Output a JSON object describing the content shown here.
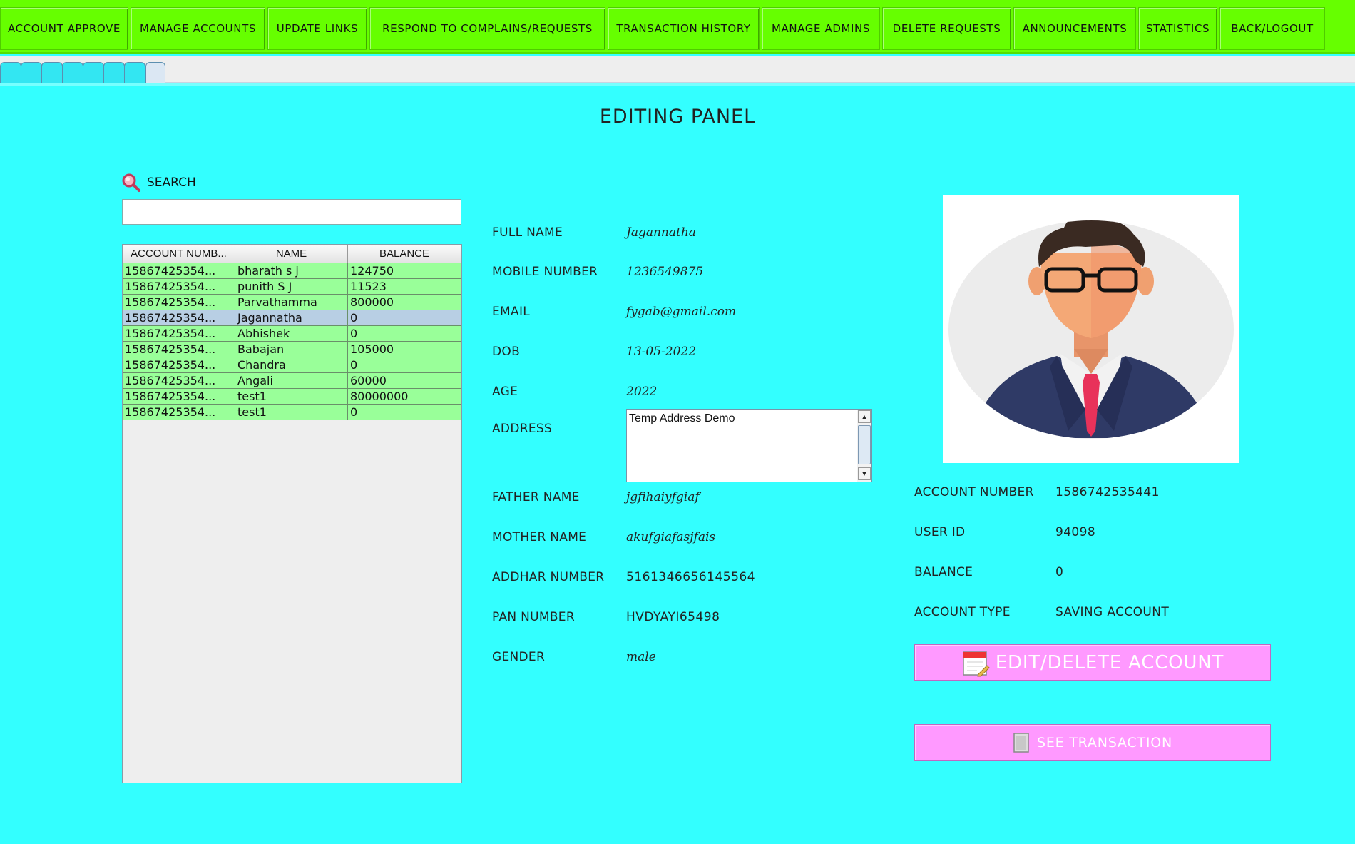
{
  "nav": [
    {
      "label": "ACCOUNT APPROVE"
    },
    {
      "label": "MANAGE ACCOUNTS"
    },
    {
      "label": "UPDATE LINKS"
    },
    {
      "label": "RESPOND TO COMPLAINS/REQUESTS"
    },
    {
      "label": "TRANSACTION HISTORY"
    },
    {
      "label": "MANAGE ADMINS"
    },
    {
      "label": "DELETE REQUESTS"
    },
    {
      "label": "ANNOUNCEMENTS"
    },
    {
      "label": "STATISTICS"
    },
    {
      "label": "BACK/LOGOUT"
    }
  ],
  "panel_title": "EDITING PANEL",
  "search": {
    "label": "SEARCH",
    "value": "",
    "icon": "magnifier-icon"
  },
  "table": {
    "headers": [
      "ACCOUNT NUMB...",
      "NAME",
      "BALANCE"
    ],
    "rows": [
      {
        "account": "15867425354...",
        "name": "bharath s j",
        "balance": "124750"
      },
      {
        "account": "15867425354...",
        "name": "punith S J",
        "balance": "11523"
      },
      {
        "account": "15867425354...",
        "name": "Parvathamma",
        "balance": "800000"
      },
      {
        "account": "15867425354...",
        "name": "Jagannatha",
        "balance": "0"
      },
      {
        "account": "15867425354...",
        "name": "Abhishek",
        "balance": "0"
      },
      {
        "account": "15867425354...",
        "name": "Babajan",
        "balance": "105000"
      },
      {
        "account": "15867425354...",
        "name": "Chandra",
        "balance": "0"
      },
      {
        "account": "15867425354...",
        "name": "Angali",
        "balance": "60000"
      },
      {
        "account": "15867425354...",
        "name": "test1",
        "balance": "80000000"
      },
      {
        "account": "15867425354...",
        "name": "test1",
        "balance": "0"
      }
    ],
    "selected_index": 3
  },
  "details": {
    "full_name": {
      "label": "FULL NAME",
      "value": "Jagannatha"
    },
    "mobile": {
      "label": "MOBILE NUMBER",
      "value": "1236549875"
    },
    "email": {
      "label": "EMAIL",
      "value": "fygab@gmail.com"
    },
    "dob": {
      "label": "DOB",
      "value": "13-05-2022"
    },
    "age": {
      "label": "AGE",
      "value": "2022"
    },
    "address": {
      "label": "ADDRESS",
      "value": "Temp Address Demo"
    },
    "father": {
      "label": "FATHER NAME",
      "value": "jgfihaiyfgiaf"
    },
    "mother": {
      "label": "MOTHER NAME",
      "value": "akufgiafasjfais"
    },
    "aadhar": {
      "label": "ADDHAR NUMBER",
      "value": "5161346656145564"
    },
    "pan": {
      "label": "PAN NUMBER",
      "value": "HVDYAYI65498"
    },
    "gender": {
      "label": "GENDER",
      "value": "male"
    }
  },
  "account": {
    "number": {
      "label": "ACCOUNT NUMBER",
      "value": "1586742535441"
    },
    "user_id": {
      "label": "USER ID",
      "value": "94098"
    },
    "balance": {
      "label": "BALANCE",
      "value": "0"
    },
    "type": {
      "label": "ACCOUNT TYPE",
      "value": "SAVING ACCOUNT"
    }
  },
  "buttons": {
    "edit_delete": {
      "label": "EDIT/DELETE  ACCOUNT",
      "icon": "calendar-edit-icon"
    },
    "see_transaction": {
      "label": "SEE TRANSACTION",
      "icon": "document-icon"
    }
  },
  "avatar": {
    "icon": "user-avatar-icon"
  },
  "colors": {
    "nav": "#66ff00",
    "background": "#33ffff",
    "row": "#99ff99",
    "selected_row": "#b8cfe4",
    "action": "#ff99ff"
  }
}
